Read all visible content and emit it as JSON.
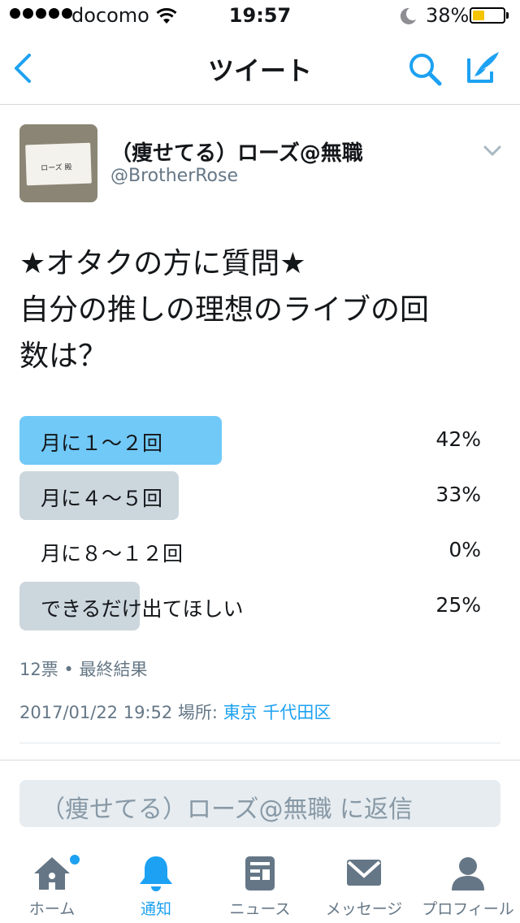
{
  "status_bar": {
    "carrier": "docomo",
    "time": "19:57",
    "battery": "38%",
    "battery_level": 0.38
  },
  "nav": {
    "title": "ツイート"
  },
  "tweet": {
    "display_name": "（痩せてる）ローズ@無職",
    "handle": "@BrotherRose",
    "avatar_card_text": "ローズ 殿",
    "text": "★オタクの方に質問★\n自分の推しの理想のライブの回\n数は？"
  },
  "poll": {
    "options": [
      {
        "label": "月に１〜２回",
        "percent": "42%",
        "value": 42,
        "winner": true
      },
      {
        "label": "月に４〜５回",
        "percent": "33%",
        "value": 33,
        "winner": false
      },
      {
        "label": "月に８〜１２回",
        "percent": "0%",
        "value": 0,
        "winner": false
      },
      {
        "label": "できるだけ出てほしい",
        "percent": "25%",
        "value": 25,
        "winner": false
      }
    ],
    "votes": "12票",
    "separator": "•",
    "status": "最終結果"
  },
  "timestamp": {
    "datetime": "2017/01/22 19:52",
    "location_label": "場所:",
    "location": "東京 千代田区"
  },
  "reply": {
    "placeholder": "（痩せてる）ローズ@無職 に返信"
  },
  "tabbar": {
    "items": [
      {
        "label": "ホーム",
        "icon": "home-icon"
      },
      {
        "label": "通知",
        "icon": "bell-icon"
      },
      {
        "label": "ニュース",
        "icon": "news-icon"
      },
      {
        "label": "メッセージ",
        "icon": "envelope-icon"
      },
      {
        "label": "プロフィール",
        "icon": "person-icon"
      }
    ]
  },
  "colors": {
    "accent": "#1da1f2",
    "poll_winner": "#71c9f8",
    "poll_other": "#ccd6dd",
    "secondary_text": "#657786",
    "battery": "#f5c400"
  }
}
